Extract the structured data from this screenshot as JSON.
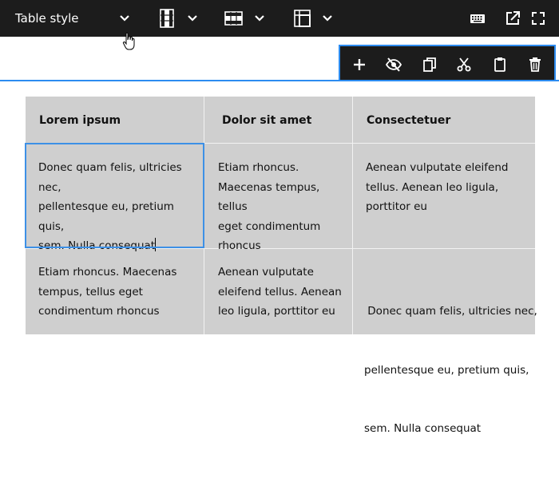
{
  "toolbar": {
    "table_style_label": "Table style",
    "icons": [
      "chevron-down-icon",
      "column-icon",
      "row-icon",
      "cell-icon",
      "keyboard-icon",
      "open-external-icon",
      "fullscreen-icon"
    ]
  },
  "block_actions": {
    "icons": [
      "add-icon",
      "hide-icon",
      "copy-icon",
      "cut-icon",
      "paste-icon",
      "delete-icon"
    ]
  },
  "table": {
    "headers": [
      "Lorem ipsum",
      "Dolor sit amet",
      "Consectetuer"
    ],
    "rows": [
      {
        "c0": [
          "Donec quam felis, ultricies nec,",
          "pellentesque eu, pretium quis,",
          "sem. Nulla consequat"
        ],
        "c1": [
          "Etiam rhoncus.",
          "Maecenas tempus, tellus",
          "eget condimentum",
          "rhoncus"
        ],
        "c2": [
          "Aenean vulputate eleifend",
          "tellus. Aenean leo ligula,",
          "porttitor eu"
        ]
      },
      {
        "c0": [
          "Etiam rhoncus. Maecenas",
          "tempus, tellus eget",
          "condimentum rhoncus"
        ],
        "c1": [
          "Aenean vulputate",
          "eleifend tellus. Aenean",
          "leo ligula, porttitor eu"
        ],
        "c2": [
          " Donec quam felis, ultricies nec,",
          "pellentesque eu, pretium quis,",
          "sem. Nulla consequat"
        ]
      }
    ]
  },
  "colors": {
    "toolbar_bg": "#1c1c1c",
    "accent": "#2d8cf0",
    "cell_bg": "#cfcfcf"
  }
}
